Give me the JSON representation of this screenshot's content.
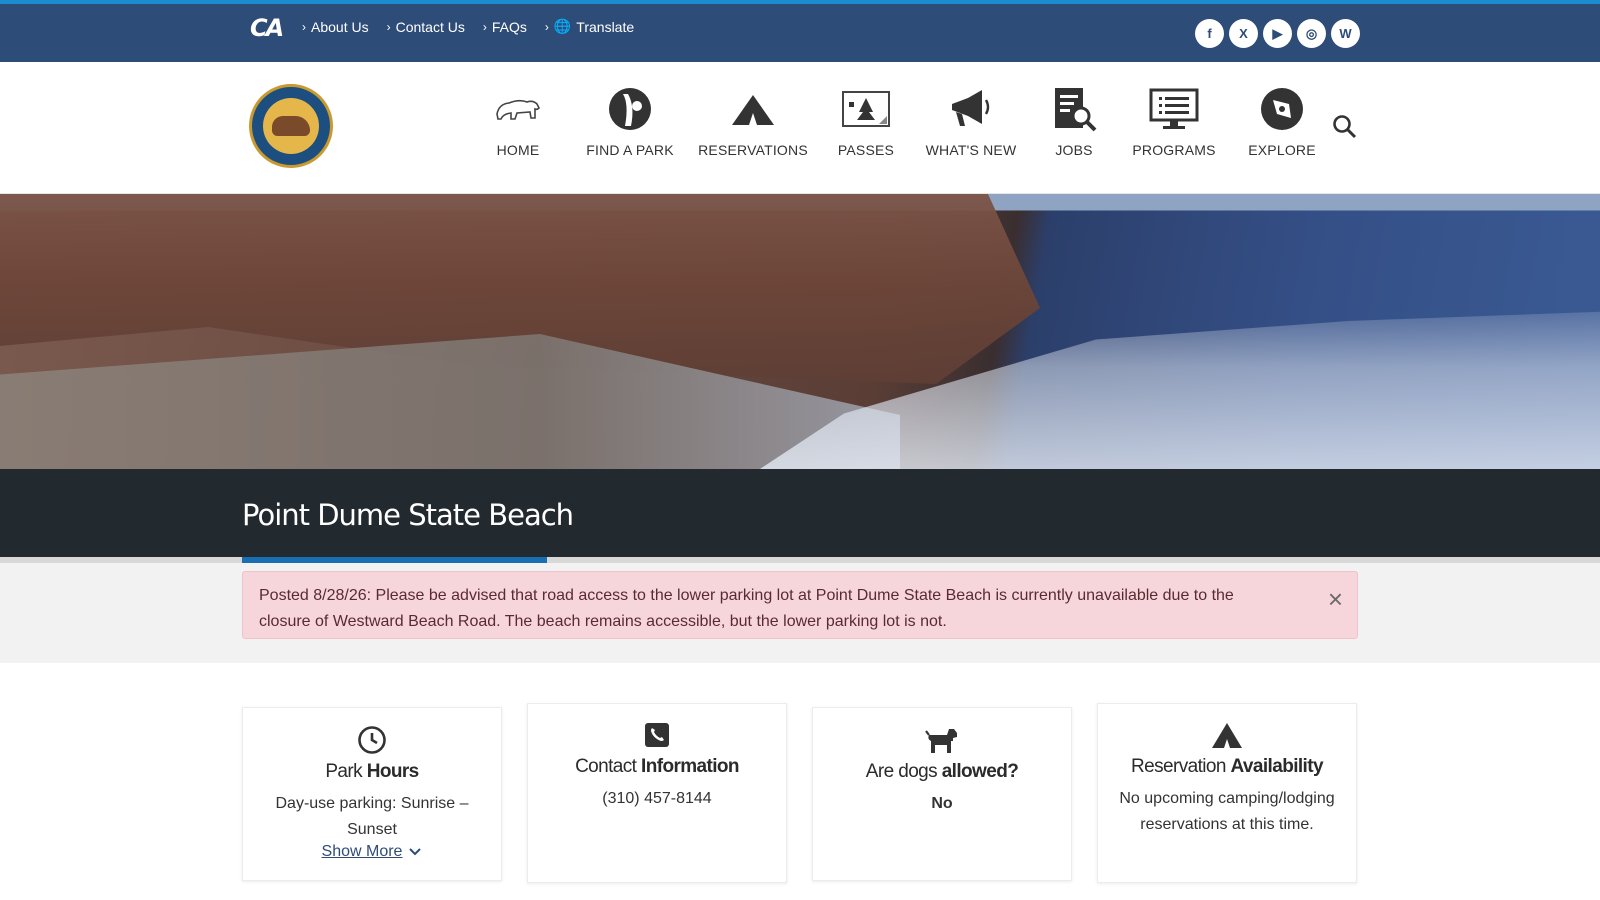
{
  "utility": {
    "logo_text": "CA",
    "links": [
      {
        "label": "About Us"
      },
      {
        "label": "Contact Us"
      },
      {
        "label": "FAQs"
      },
      {
        "label": "Translate"
      }
    ],
    "social": [
      {
        "name": "facebook-icon",
        "glyph": "f"
      },
      {
        "name": "x-twitter-icon",
        "glyph": "X"
      },
      {
        "name": "youtube-icon",
        "glyph": "▶"
      },
      {
        "name": "instagram-icon",
        "glyph": "◎"
      },
      {
        "name": "wordpress-icon",
        "glyph": "W"
      }
    ]
  },
  "nav": {
    "items": [
      {
        "label": "HOME",
        "icon": "bear-icon"
      },
      {
        "label": "FIND A PARK",
        "icon": "map-pin-icon"
      },
      {
        "label": "RESERVATIONS",
        "icon": "tent-icon"
      },
      {
        "label": "PASSES",
        "icon": "pass-card-icon"
      },
      {
        "label": "WHAT'S NEW",
        "icon": "megaphone-icon"
      },
      {
        "label": "JOBS",
        "icon": "job-search-icon"
      },
      {
        "label": "PROGRAMS",
        "icon": "monitor-list-icon"
      },
      {
        "label": "EXPLORE",
        "icon": "compass-icon"
      }
    ]
  },
  "page": {
    "title": "Point Dume State Beach"
  },
  "alert": {
    "text": "Posted 8/28/26: Please be advised that road access to the lower parking lot at Point Dume State Beach is currently unavailable due to the closure of Westward Beach Road. The beach remains accessible, but the lower parking lot is not.",
    "close_label": "×"
  },
  "cards": {
    "hours": {
      "title_light": "Park ",
      "title_bold": "Hours",
      "body": "Day-use parking: Sunrise – Sunset",
      "link": "Show More"
    },
    "contact": {
      "title_light": "Contact ",
      "title_bold": "Information",
      "body": "(310) 457-8144"
    },
    "dogs": {
      "title_light": "Are dogs ",
      "title_bold": "allowed?",
      "body": "No"
    },
    "reservation": {
      "title_light": "Reservation ",
      "title_bold": "Availability",
      "body": "No upcoming camping/lodging reservations at this time."
    }
  },
  "colors": {
    "utility_bar": "#2e4c78",
    "accent": "#1a6fb3",
    "title_band": "#22292f",
    "alert_bg": "#f7d6db"
  }
}
